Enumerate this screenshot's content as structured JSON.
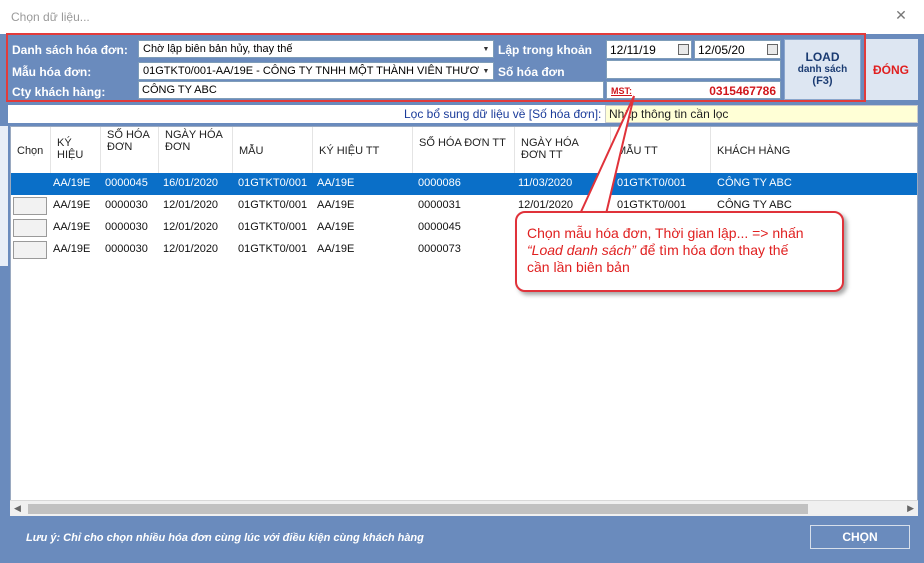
{
  "window": {
    "title": "Chọn dữ liệu...",
    "close_glyph": "✕"
  },
  "filter": {
    "ds_label": "Danh sách hóa đơn:",
    "ds_value": "Chờ lập biên bản hủy, thay thế",
    "mau_label": "Mẫu hóa đơn:",
    "mau_value": "01GTKT0/001-AA/19E - CÔNG TY TNHH MỘT THÀNH VIÊN THƯƠ",
    "cty_label": "Cty khách hàng:",
    "cty_value": "CÔNG TY ABC",
    "lap_label": "Lập trong khoản",
    "date_from": "12/11/19",
    "date_to": "12/05/20",
    "sohd_label": "Số hóa đơn",
    "sohd_value": "",
    "mst_label": "MST:",
    "mst_value": "0315467786",
    "load_line1": "LOAD",
    "load_line2": "danh sách",
    "load_line3": "(F3)",
    "dong_label": "ĐÓNG"
  },
  "filter_row": {
    "hint": "Lọc bổ sung dữ liệu về [Số hóa đơn]:",
    "placeholder": "Nhập thông tin cần lọc"
  },
  "table": {
    "columns": [
      "Chọn",
      "KÝ HIỆU",
      "SỐ HÓA ĐƠN",
      "NGÀY HÓA ĐƠN",
      "MẪU",
      "KÝ HIỆU TT",
      "SỐ HÓA ĐƠN TT",
      "NGÀY HÓA ĐƠN TT",
      "MẪU TT",
      "KHÁCH HÀNG"
    ],
    "rows": [
      [
        "",
        "AA/19E",
        "0000045",
        "16/01/2020",
        "01GTKT0/001",
        "AA/19E",
        "0000086",
        "11/03/2020",
        "01GTKT0/001",
        "CÔNG TY ABC"
      ],
      [
        "",
        "AA/19E",
        "0000030",
        "12/01/2020",
        "01GTKT0/001",
        "AA/19E",
        "0000031",
        "12/01/2020",
        "01GTKT0/001",
        "CÔNG TY ABC"
      ],
      [
        "",
        "AA/19E",
        "0000030",
        "12/01/2020",
        "01GTKT0/001",
        "AA/19E",
        "0000045",
        "",
        "",
        ""
      ],
      [
        "",
        "AA/19E",
        "0000030",
        "12/01/2020",
        "01GTKT0/001",
        "AA/19E",
        "0000073",
        "",
        "",
        ""
      ]
    ]
  },
  "callout": {
    "line1": "Chọn mẫu hóa đơn, Thời gian lập... => nhấn",
    "load_phrase": "“Load danh sách”",
    "line2_rest": " để tìm hóa đơn thay thế",
    "line3": "cần lần biên bản"
  },
  "footer": {
    "note": "Lưu ý: Chỉ cho chọn nhiều hóa đơn cùng lúc với điều kiện cùng khách hàng",
    "chon_label": "CHỌN"
  },
  "colors": {
    "frame": "#6a8bbd",
    "selected_row": "#0a6fc8",
    "accent_red": "#e02020"
  }
}
